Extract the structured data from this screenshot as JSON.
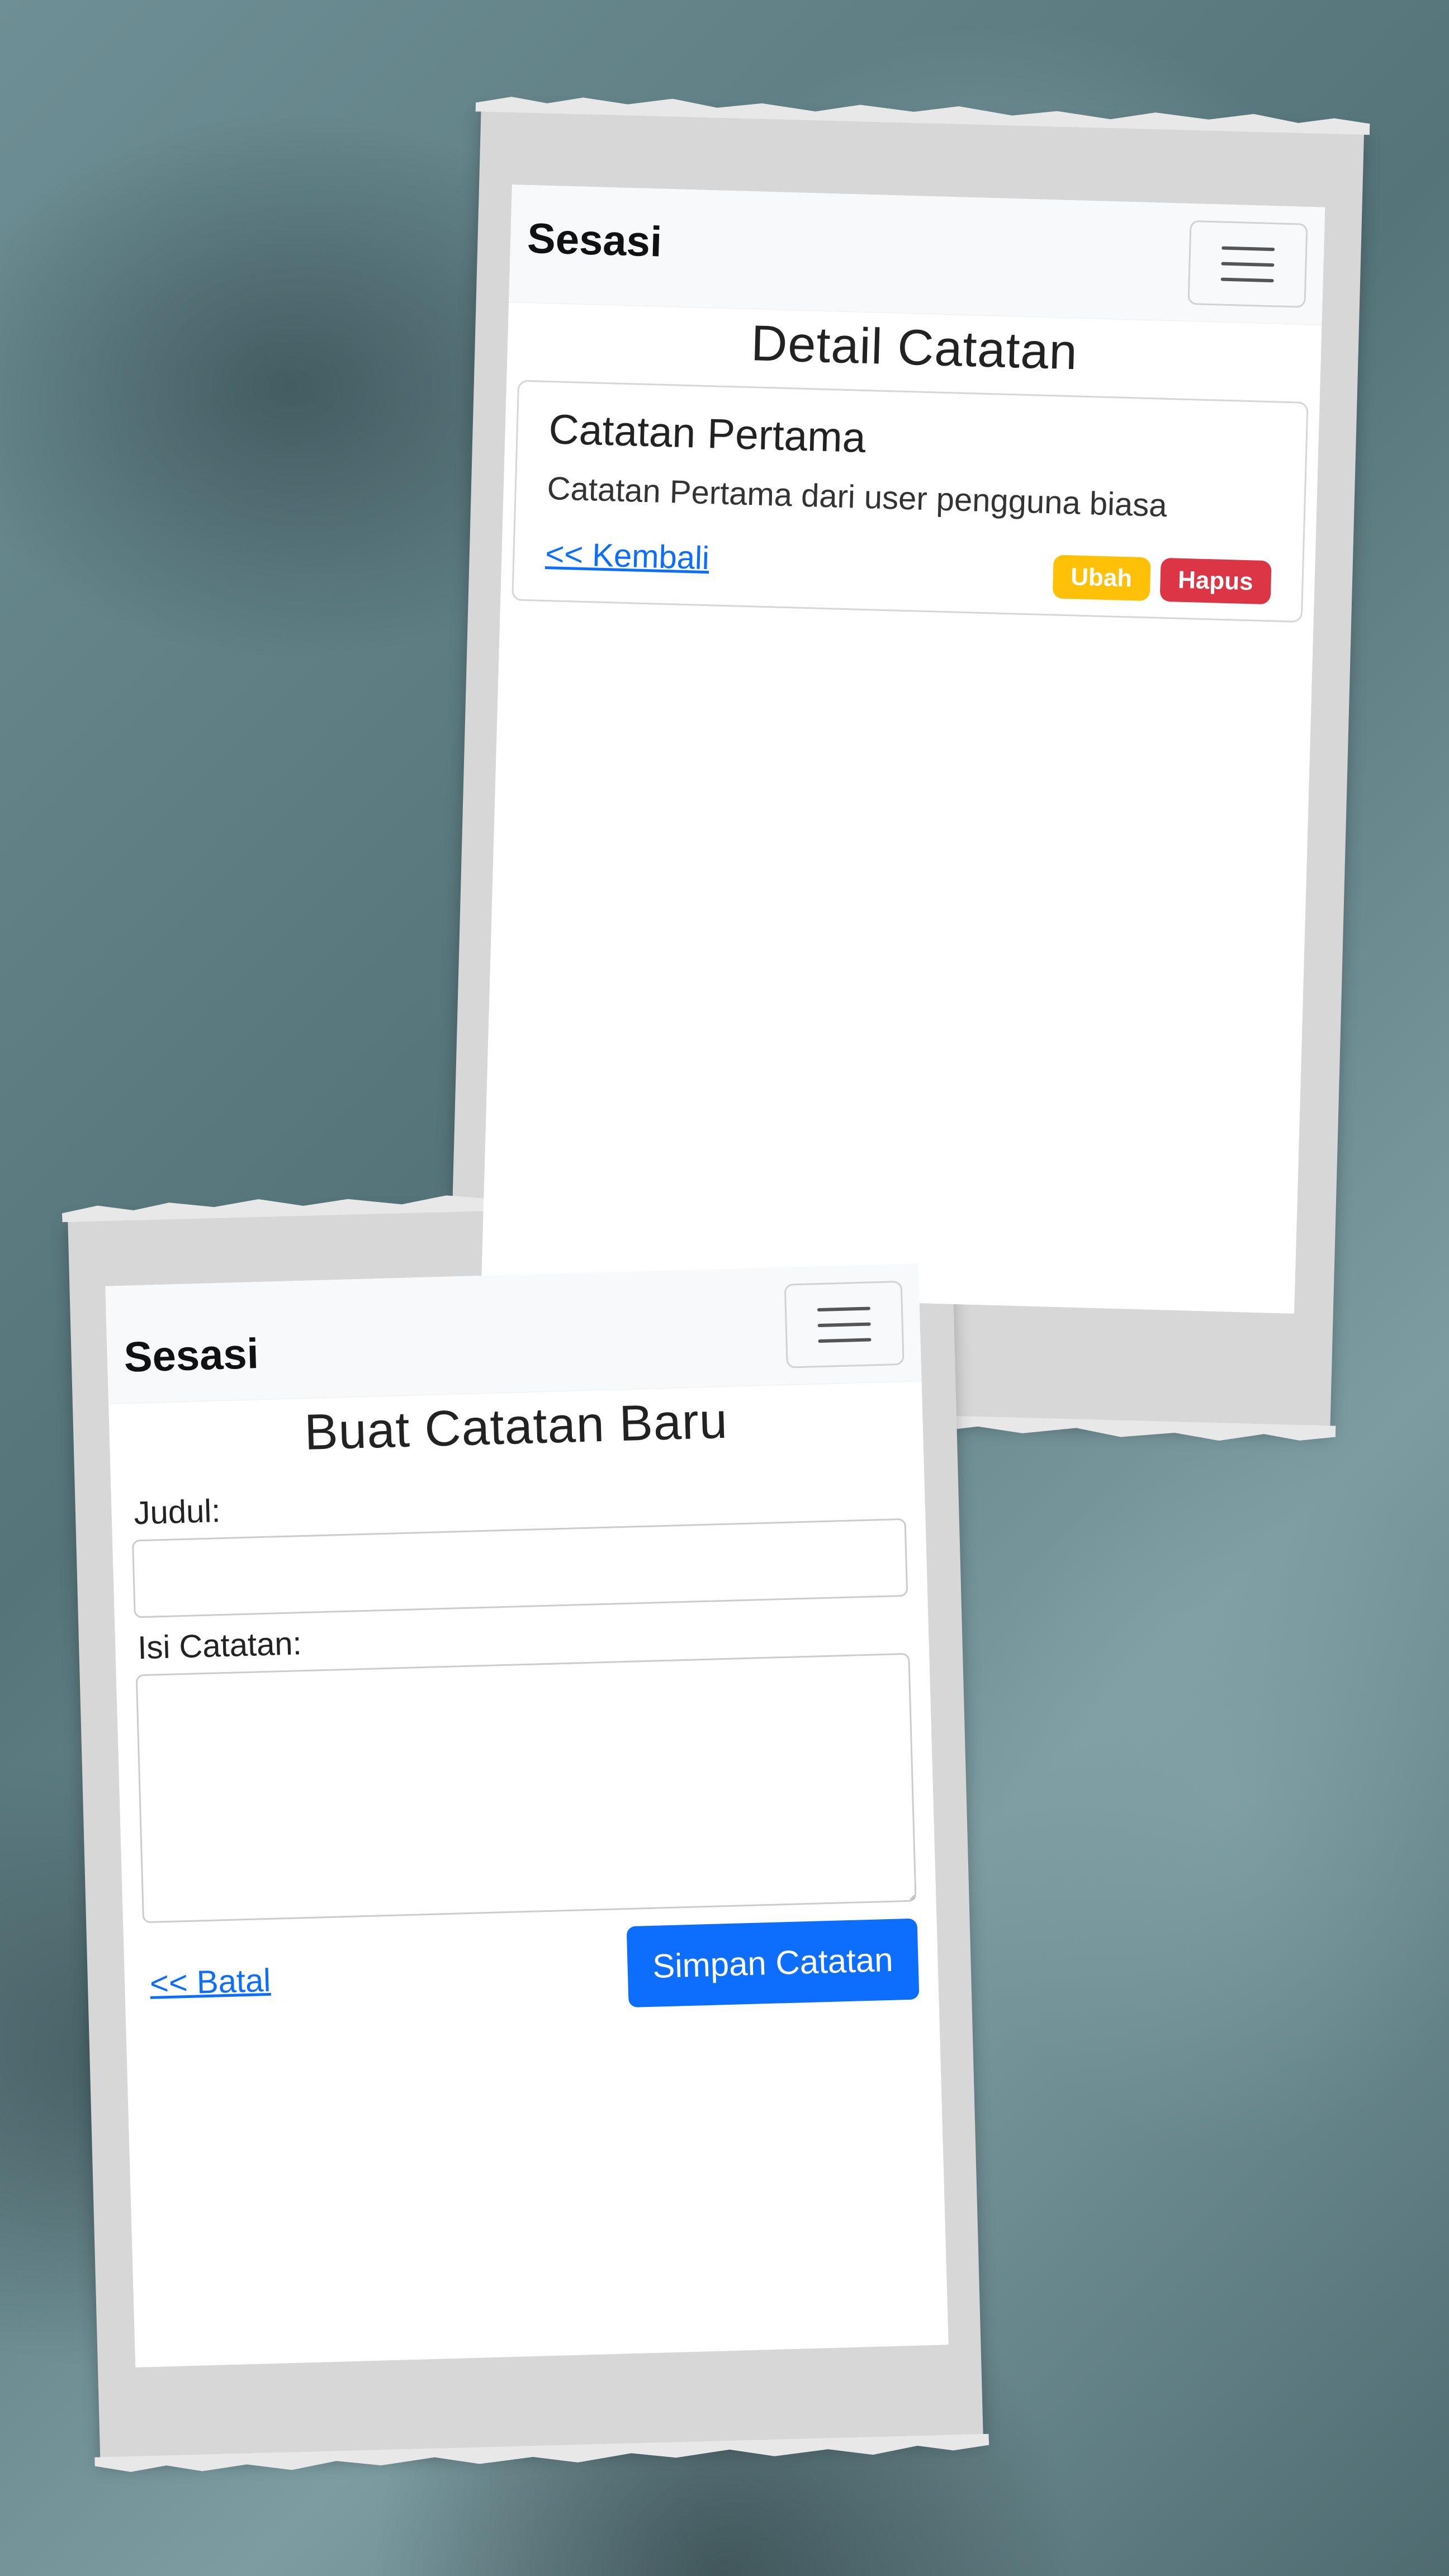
{
  "detail_screen": {
    "navbar": {
      "brand": "Sesasi"
    },
    "title": "Detail Catatan",
    "note": {
      "title": "Catatan Pertama",
      "body": "Catatan Pertama dari user pengguna biasa"
    },
    "back_link": "<< Kembali",
    "edit_label": "Ubah",
    "delete_label": "Hapus"
  },
  "create_screen": {
    "navbar": {
      "brand": "Sesasi"
    },
    "title": "Buat Catatan Baru",
    "judul_label": "Judul:",
    "judul_value": "",
    "isi_label": "Isi Catatan:",
    "isi_value": "",
    "cancel_link": "<< Batal",
    "save_label": "Simpan Catatan"
  },
  "colors": {
    "primary": "#0d6efd",
    "warning": "#ffc107",
    "danger": "#dc3545",
    "navbar_bg": "#f8f9fa"
  }
}
